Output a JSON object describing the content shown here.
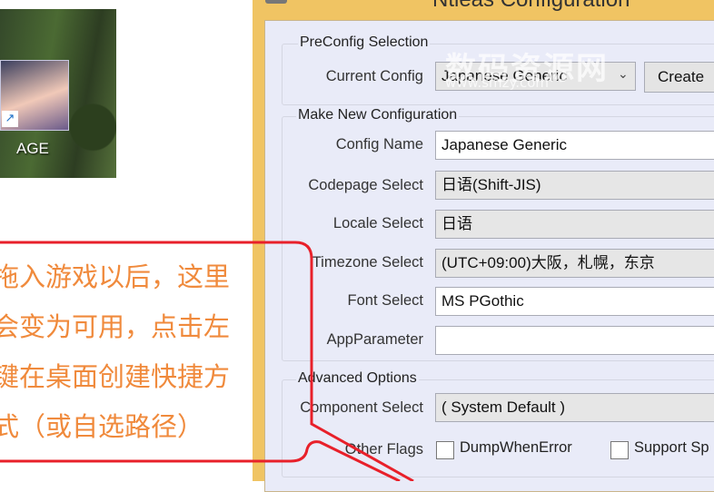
{
  "desktop": {
    "icon_label": "AGE"
  },
  "window": {
    "title": "Ntleas Configuration"
  },
  "preconfig": {
    "title": "PreConfig Selection",
    "current_label": "Current Config",
    "current_value": "Japanese Generic",
    "create_label": "Create"
  },
  "make_new": {
    "title": "Make New Configuration",
    "config_name_label": "Config Name",
    "config_name_value": "Japanese Generic",
    "codepage_label": "Codepage Select",
    "codepage_value": "日语(Shift-JIS)",
    "locale_label": "Locale Select",
    "locale_value": "日语",
    "timezone_label": "Timezone Select",
    "timezone_value": "(UTC+09:00)大阪，札幌，东京",
    "font_label": "Font Select",
    "font_value": "MS PGothic",
    "app_param_label": "AppParameter",
    "app_param_value": ""
  },
  "advanced": {
    "title": "Advanced Options",
    "component_label": "Component Select",
    "component_value": "( System Default )",
    "other_flags_label": "Other Flags",
    "flags": [
      {
        "label": "DumpWhenError",
        "checked": false
      },
      {
        "label": "Support Sp",
        "checked": false
      }
    ]
  },
  "annotation": {
    "lines": [
      "拖入游戏以后，这里",
      "会变为可用，点击左",
      "键在桌面创建快捷方",
      "式（或自选路径）"
    ],
    "color": "#e8202a",
    "text_color": "#f08a3c"
  },
  "watermark": {
    "text": "数码资源网",
    "url": "www.smzy.com"
  }
}
